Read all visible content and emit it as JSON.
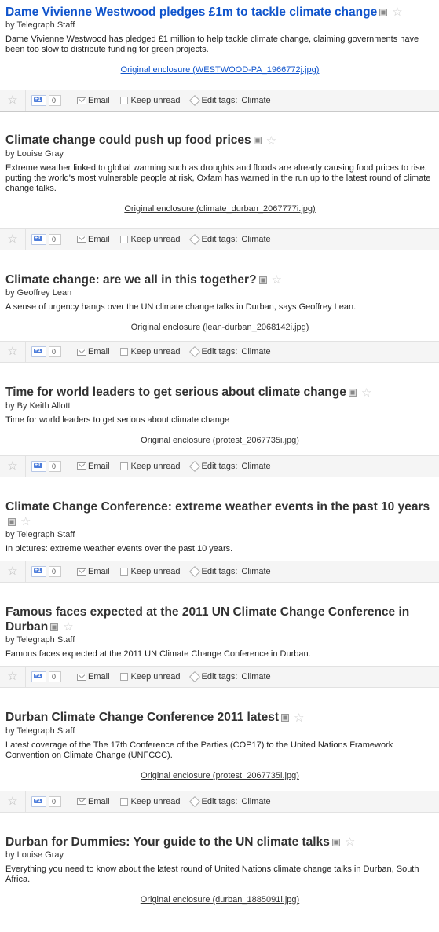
{
  "actions": {
    "star_glyph": "☆",
    "plus_count": "0",
    "email_label": "Email",
    "keep_unread_label": "Keep unread",
    "edit_tags_label": "Edit tags:"
  },
  "entries": [
    {
      "title": "Dame Vivienne Westwood pledges £1m to tackle climate change",
      "author": "by Telegraph Staff",
      "snippet": "Dame Vivienne Westwood has pledged £1 million to help tackle climate change, claiming governments have been too slow to distribute funding for green projects.",
      "enclosure": "Original enclosure (WESTWOOD-PA_1966772j.jpg)",
      "tags": "Climate"
    },
    {
      "title": "Climate change could push up food prices",
      "author": "by Louise Gray",
      "snippet": "Extreme weather linked to global warming such as droughts and floods are already causing food prices to rise, putting the world's most vulnerable people at risk, Oxfam has warned in the run up to the latest round of climate change talks.",
      "enclosure": "Original enclosure (climate_durban_2067777i.jpg)",
      "tags": "Climate"
    },
    {
      "title": "Climate change: are we all in this together?",
      "author": "by Geoffrey Lean",
      "snippet": "A sense of urgency hangs over the UN climate change talks in Durban, says Geoffrey Lean.",
      "enclosure": "Original enclosure (lean-durban_2068142i.jpg)",
      "tags": "Climate"
    },
    {
      "title": "Time for world leaders to get serious about climate change",
      "author": "by By Keith Allott",
      "snippet": "Time for world leaders to get serious about climate change",
      "enclosure": "Original enclosure (protest_2067735i.jpg)",
      "tags": "Climate"
    },
    {
      "title": "Climate Change Conference: extreme weather events in the past 10 years",
      "author": "by Telegraph Staff",
      "snippet": "In pictures: extreme weather events over the past 10 years.",
      "enclosure": "",
      "tags": "Climate"
    },
    {
      "title": "Famous faces expected at the 2011 UN Climate Change Conference in Durban",
      "author": "by Telegraph Staff",
      "snippet": "Famous faces expected at the 2011 UN Climate Change Conference in Durban.",
      "enclosure": "",
      "tags": "Climate"
    },
    {
      "title": "Durban Climate Change Conference 2011 latest",
      "author": "by Telegraph Staff",
      "snippet": "Latest coverage of the The 17th Conference of the Parties (COP17) to the United Nations Framework Convention on Climate Change (UNFCCC).",
      "enclosure": "Original enclosure (protest_2067735i.jpg)",
      "tags": "Climate"
    },
    {
      "title": "Durban for Dummies: Your guide to the UN climate talks",
      "author": "by Louise Gray",
      "snippet": "Everything you need to know about the latest round of United Nations climate change talks in Durban, South Africa.",
      "enclosure": "Original enclosure (durban_1885091i.jpg)",
      "tags": ""
    }
  ]
}
